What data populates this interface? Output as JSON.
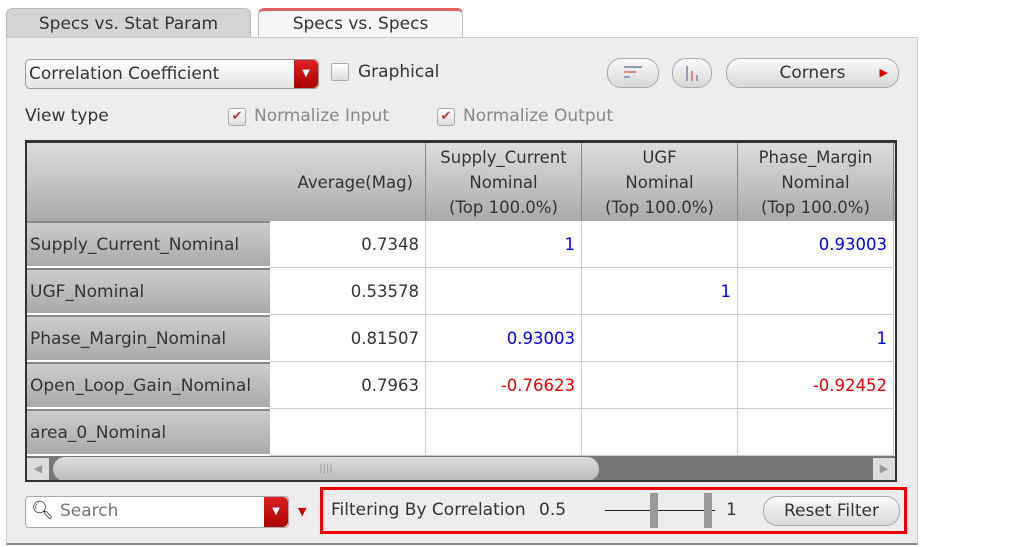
{
  "tabs": [
    "Specs vs. Stat Param",
    "Specs vs. Specs"
  ],
  "toolbar": {
    "metric": "Correlation Coefficient",
    "graphical_label": "Graphical",
    "graphical_checked": false,
    "corners_label": "Corners"
  },
  "view": {
    "label": "View type",
    "normalize_input": "Normalize Input",
    "normalize_output": "Normalize Output"
  },
  "table": {
    "columns": [
      {
        "lines": [
          "",
          "Average(Mag)",
          ""
        ]
      },
      {
        "lines": [
          "Supply_Current",
          "Nominal",
          "(Top 100.0%)"
        ]
      },
      {
        "lines": [
          "UGF",
          "Nominal",
          "(Top 100.0%)"
        ]
      },
      {
        "lines": [
          "Phase_Margin",
          "Nominal",
          "(Top 100.0%)"
        ]
      }
    ],
    "rows": [
      {
        "name": "Supply_Current_Nominal",
        "values": [
          "0.7348",
          "1",
          "",
          "0.93003"
        ]
      },
      {
        "name": "UGF_Nominal",
        "values": [
          "0.53578",
          "",
          "1",
          ""
        ]
      },
      {
        "name": "Phase_Margin_Nominal",
        "values": [
          "0.81507",
          "0.93003",
          "",
          "1"
        ]
      },
      {
        "name": "Open_Loop_Gain_Nominal",
        "values": [
          "0.7963",
          "-0.76623",
          "",
          "-0.92452"
        ]
      },
      {
        "name": "area_0_Nominal",
        "values": [
          "",
          "",
          "",
          ""
        ]
      }
    ]
  },
  "search": {
    "placeholder": "Search"
  },
  "filter": {
    "label": "Filtering By Correlation",
    "min": "0.5",
    "max": "1",
    "reset_label": "Reset Filter"
  }
}
